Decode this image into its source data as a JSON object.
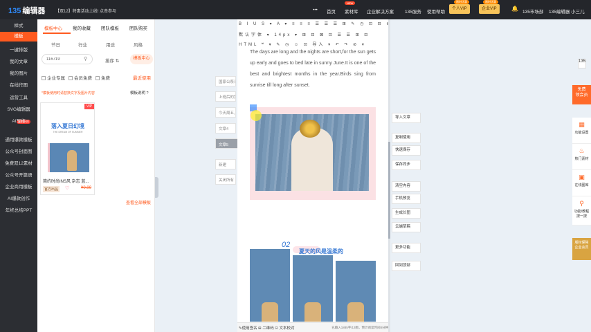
{
  "topbar": {
    "logo": "编辑器",
    "logo_digits": "135",
    "notice": "【双12】特惠活动上线! 点击参与",
    "nav": [
      "•••",
      "首页",
      "素材库",
      "企业解决方案",
      "135服务",
      "使用帮助"
    ],
    "nav_badge": "NEW",
    "vip_personal": "个人VIP",
    "vip_enterprise": "企业VIP",
    "vip_personal_badge": "限时优惠",
    "vip_enterprise_badge": "限时优惠",
    "market": "135市场部",
    "user": "135编辑器 小三儿"
  },
  "sidebar": {
    "items": [
      "样式",
      "模板",
      "一键排版",
      "我的文章",
      "我的图片",
      "在线作图",
      "运营工具",
      "SVG编辑器",
      "AI写作",
      "通用爆款模板",
      "公众号封面图",
      "免费双12素材",
      "公众号开篇语",
      "企业商用模板",
      "AI爆款创作",
      "年终总结PPT"
    ],
    "new_badge": "限时折扣"
  },
  "panel": {
    "tabs": [
      "模板中心",
      "我的收藏",
      "团队模板",
      "团队购买"
    ],
    "filters": [
      "节日",
      "行业",
      "用途",
      "风格"
    ],
    "search_value": "116719",
    "sort": "排序",
    "template_center": "模板中心",
    "checks": [
      "企业专属",
      "会员免费",
      "免费"
    ],
    "recent": "最近使用",
    "hint": "*模板使用时请替换文字及图片内容",
    "template_help": "模板说明",
    "card": {
      "vip": "VIP",
      "title": "落入夏日幻境",
      "subtitle": "THE DREAM OF SUMMER",
      "name": "简约时尚INS风 杂志 蓝...",
      "tag": "官方出品",
      "price": "¥0.00"
    },
    "view_all": "查看全部模板"
  },
  "outline": {
    "items": [
      "国家公祭日",
      "上班后的第一",
      "今天周五,",
      "文章4",
      "文章5",
      "新建",
      "关闭所有"
    ],
    "active_index": 4
  },
  "editor": {
    "toolbar1": "B I U S ▾ A ▾ ≡ ≡ ≡ ☰ ☰ ☰ ⊞ ✎ ◷ ⊡ ⊟ ⊕",
    "toolbar2": "默认字体 ▾ 14px ▾ ⊞ ⊟ ⊠ ⊡ ☰ ☰ ⊞ ⊟",
    "toolbar3": "HTML ❝ ▾ ✎ ◷ ☺ ⊡ 导入 ▾ ↶ ↷ ⊘ ▾",
    "font": "默认字体",
    "size": "14px",
    "body_text": "The days are long and the nights are short,for the sun gets up early and goes to bed late in sunny June.It is one of the best and brightest months in the year.Birds sing from sunrise till long after sunset.",
    "section_num": "02",
    "section_title": "夏天的风是温柔的",
    "status_left": "✎使用签名    ⊞ 二维码    ⊡ 文本校对",
    "status_right": "已输入1885字/13图，预计阅读时间8分钟"
  },
  "actions": [
    "导入文章",
    "复制使用",
    "快速保存",
    "保存同步",
    "清空内容",
    "手机预览",
    "生成长图",
    "云端草稿",
    "更多功能",
    "回到顶部"
  ],
  "rightbar": {
    "top_icon": "135",
    "free_line1": "免费",
    "free_line2": "领会员",
    "items": [
      "功能设置",
      "热门素材",
      "在线图库",
      "功能/教程 搜一搜"
    ],
    "vip_line1": "版权保障",
    "vip_line2": "企业会员"
  },
  "icons": [
    "search-icon",
    "sort-icon",
    "help-icon",
    "heart-icon",
    "bell-icon",
    "grid-icon",
    "fire-icon",
    "image-icon",
    "search2-icon"
  ]
}
